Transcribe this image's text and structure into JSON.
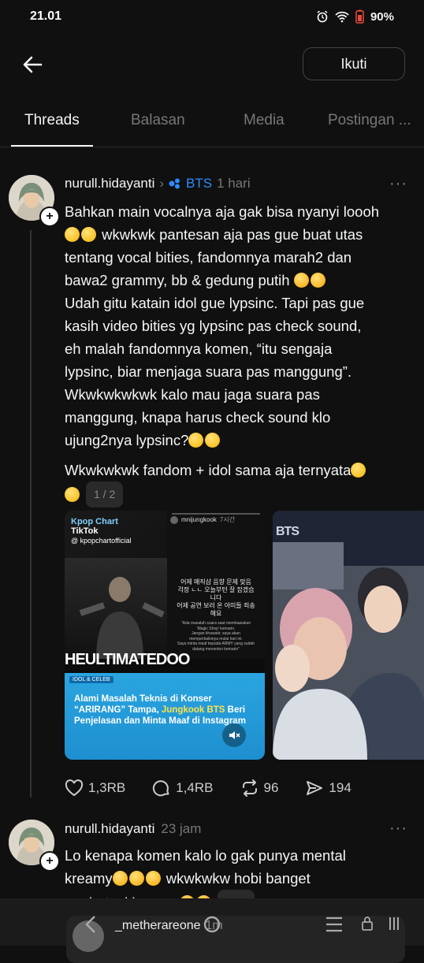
{
  "status_bar": {
    "time": "21.01",
    "battery": "90%"
  },
  "header": {
    "follow_label": "Ikuti"
  },
  "tabs": [
    {
      "label": "Threads"
    },
    {
      "label": "Balasan"
    },
    {
      "label": "Media"
    },
    {
      "label": "Postingan ..."
    }
  ],
  "post1": {
    "username": "nurull.hidayanti",
    "community": "BTS",
    "time": "1 hari",
    "lines": [
      "Bahkan main vocalnya aja gak bisa nyanyi loooh",
      " wkwkwk pantesan aja pas gue buat utas",
      "tentang vocal bities, fandomnya marah2 dan",
      "bawa2 grammy, bb & gedung putih ",
      "Udah gitu katain idol gue lypsinc. Tapi pas gue",
      "kasih video bities yg lypsinc pas check sound,",
      "eh malah fandomnya komen, “itu sengaja",
      "lypsinc, biar menjaga suara pas manggung”.",
      "Wkwkwkwkwk  kalo mau jaga suara pas",
      "manggung, knapa harus check sound klo",
      "ujung2nya lypsinc?"
    ],
    "line2": "Wkwkwkwk fandom + idol sama aja ternyata",
    "page": "1 / 2",
    "media1": {
      "app": "TikTok",
      "brand": "Kpop Chart",
      "handle": "@ kpopchartofficial",
      "ig_user": "mnijungkook",
      "ig_time": "7시간",
      "korean_lines": [
        "어제 매직샵 음향 문제 맞음",
        "걱정 ㄴㄴ 오늘부턴 잘 잡겠습",
        "니다",
        "어제 공연 보러 온 아미들 죄송",
        "해요"
      ],
      "quote_lines": [
        "\"Ada masalah suara saat membawakan",
        "'Magic Shop' kemarin.",
        "Jangan khawatir, saya akan",
        "memperbaikinya mulai hari ini.",
        "Saya minta maaf kepada ARMY yang sudah",
        "datang menonton kemarin\""
      ],
      "poster": "HEULTIMATEDOO",
      "tag": "IDOL & CELEB",
      "headline_a": "Alami Masalah Teknis di Konser",
      "headline_b1": "“ARIRANG” Tampa, ",
      "headline_b2": "Jungkook BTS",
      "headline_b3": " Beri",
      "headline_c": "Penjelasan dan Minta Maaf di Instagram"
    },
    "media2": {
      "logo": "BTS"
    },
    "stats": {
      "likes": "1,3RB",
      "replies": "1,4RB",
      "reposts": "96",
      "shares": "194"
    }
  },
  "post2": {
    "username": "nurull.hidayanti",
    "time": "23 jam",
    "lines": [
      "Lo kenapa komen kalo lo gak punya mental",
      "kreamy",
      " wkwkwkw hobi banget",
      "ngebatasi komen "
    ],
    "page": "2 / 2",
    "quoted_user": "_metherareone",
    "quoted_time": "1m"
  },
  "colors": {
    "bg": "#101010",
    "accent_blue": "#2d8cff"
  }
}
